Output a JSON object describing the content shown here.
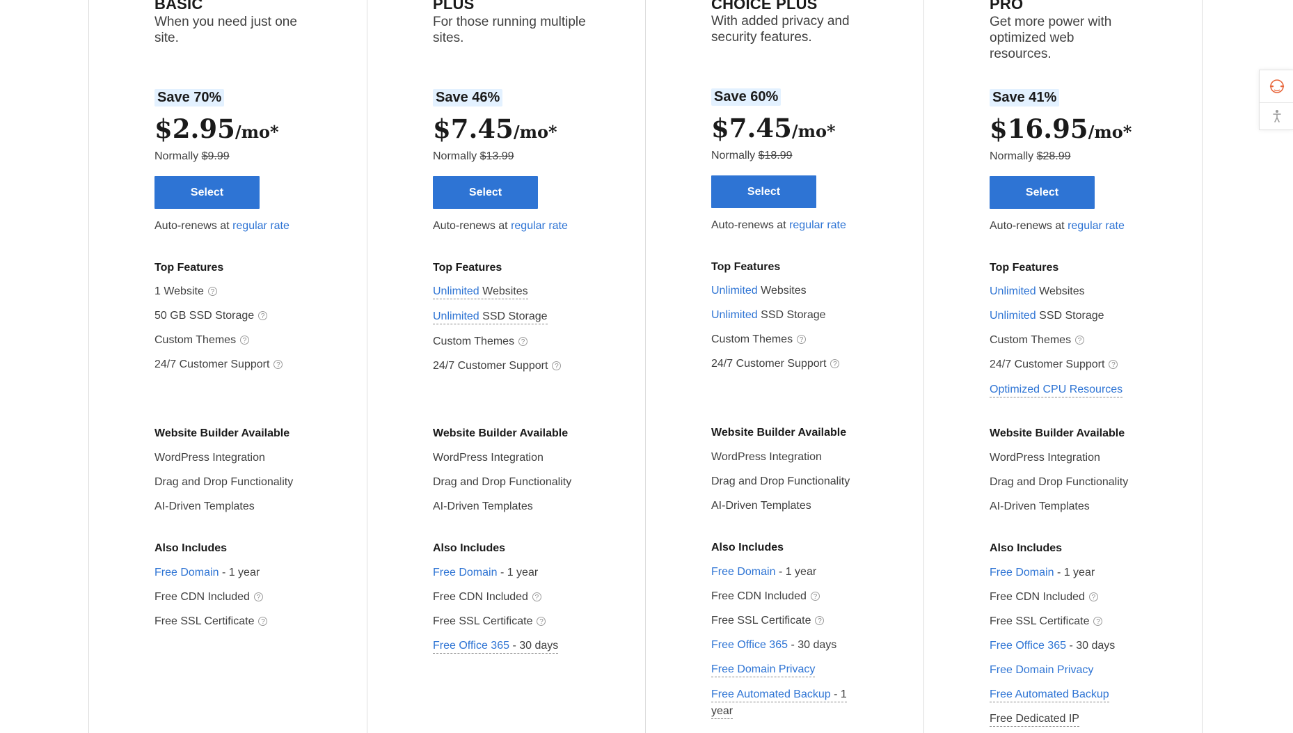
{
  "plans": [
    {
      "name": "BASIC",
      "desc": "When you need just one site.",
      "save": "Save 70%",
      "price": "$2.95",
      "per": "/mo*",
      "normally_label": "Normally",
      "normally_price": "$9.99",
      "select": "Select",
      "autorenew_text": "Auto-renews at",
      "autorenew_link": "regular rate",
      "top_features_title": "Top Features",
      "website_builder_title": "Website Builder Available",
      "also_includes_title": "Also Includes"
    },
    {
      "name": "PLUS",
      "desc": "For those running multiple sites.",
      "save": "Save 46%",
      "price": "$7.45",
      "per": "/mo*",
      "normally_label": "Normally",
      "normally_price": "$13.99",
      "select": "Select",
      "autorenew_text": "Auto-renews at",
      "autorenew_link": "regular rate",
      "top_features_title": "Top Features",
      "website_builder_title": "Website Builder Available",
      "also_includes_title": "Also Includes"
    },
    {
      "name": "CHOICE PLUS",
      "desc": "With added privacy and security features.",
      "save": "Save 60%",
      "price": "$7.45",
      "per": "/mo*",
      "normally_label": "Normally",
      "normally_price": "$18.99",
      "select": "Select",
      "autorenew_text": "Auto-renews at",
      "autorenew_link": "regular rate",
      "top_features_title": "Top Features",
      "website_builder_title": "Website Builder Available",
      "also_includes_title": "Also Includes"
    },
    {
      "name": "PRO",
      "desc": "Get more power with optimized web resources.",
      "save": "Save 41%",
      "price": "$16.95",
      "per": "/mo*",
      "normally_label": "Normally",
      "normally_price": "$28.99",
      "select": "Select",
      "autorenew_text": "Auto-renews at",
      "autorenew_link": "regular rate",
      "top_features_title": "Top Features",
      "website_builder_title": "Website Builder Available",
      "also_includes_title": "Also Includes"
    }
  ],
  "features": {
    "one_website": "1 Website",
    "ssd_50": "50 GB SSD Storage",
    "custom_themes": "Custom Themes",
    "support": "24/7 Customer Support",
    "unlimited": "Unlimited",
    "websites": "Websites",
    "ssd_storage": "SSD Storage",
    "optimized_cpu": "Optimized CPU Resources",
    "wordpress": "WordPress Integration",
    "drag_drop": "Drag and Drop Functionality",
    "ai_templates": "AI-Driven Templates",
    "free_domain": "Free Domain",
    "one_year": "- 1 year",
    "one_year_split_a": "- 1",
    "one_year_split_b": "year",
    "free_cdn": "Free CDN Included",
    "free_ssl": "Free SSL Certificate",
    "free_office": "Free Office 365",
    "thirty_days": "- 30 days",
    "free_domain_privacy": "Free Domain Privacy",
    "free_backup": "Free Automated Backup",
    "free_dedicated_ip": "Free Dedicated IP",
    "help_glyph": "?"
  },
  "colors": {
    "accent": "#2e74d4",
    "save_bg": "#e3f1ff",
    "widget_icon": "#e8673c"
  },
  "icons": {
    "widget_top": "chat-support-icon",
    "widget_bottom": "accessibility-icon"
  }
}
